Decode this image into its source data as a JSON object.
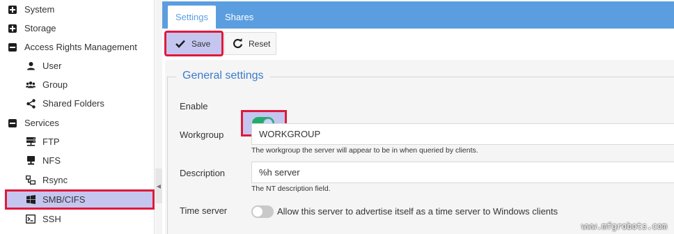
{
  "sidebar": {
    "items": [
      {
        "label": "System",
        "icon": "plus-square-icon"
      },
      {
        "label": "Storage",
        "icon": "plus-square-icon"
      },
      {
        "label": "Access Rights Management",
        "icon": "minus-square-icon"
      },
      {
        "label": "User",
        "icon": "user-icon"
      },
      {
        "label": "Group",
        "icon": "group-icon"
      },
      {
        "label": "Shared Folders",
        "icon": "share-icon"
      },
      {
        "label": "Services",
        "icon": "minus-square-icon"
      },
      {
        "label": "FTP",
        "icon": "server-icon"
      },
      {
        "label": "NFS",
        "icon": "desktop-icon"
      },
      {
        "label": "Rsync",
        "icon": "network-icon"
      },
      {
        "label": "SMB/CIFS",
        "icon": "windows-icon",
        "selected": true
      },
      {
        "label": "SSH",
        "icon": "terminal-icon"
      }
    ]
  },
  "tabs": [
    {
      "label": "Settings",
      "selected": true
    },
    {
      "label": "Shares",
      "selected": false
    }
  ],
  "toolbar": {
    "save_label": "Save",
    "reset_label": "Reset"
  },
  "general": {
    "legend": "General settings",
    "enable_label": "Enable",
    "enable_value": true,
    "workgroup_label": "Workgroup",
    "workgroup_value": "WORKGROUP",
    "workgroup_hint": "The workgroup the server will appear to be in when queried by clients.",
    "description_label": "Description",
    "description_value": "%h server",
    "description_hint": "The NT description field.",
    "timeserver_label": "Time server",
    "timeserver_value": false,
    "timeserver_text": "Allow this server to advertise itself as a time server to Windows clients"
  },
  "watermark": "www.mfgrobots.com",
  "colors": {
    "accent": "#5b9ee0",
    "highlight_fill": "#c5c6f0",
    "highlight_border": "#e0193a",
    "toggle_on": "#1fae6a",
    "legend": "#3a7bc8"
  }
}
